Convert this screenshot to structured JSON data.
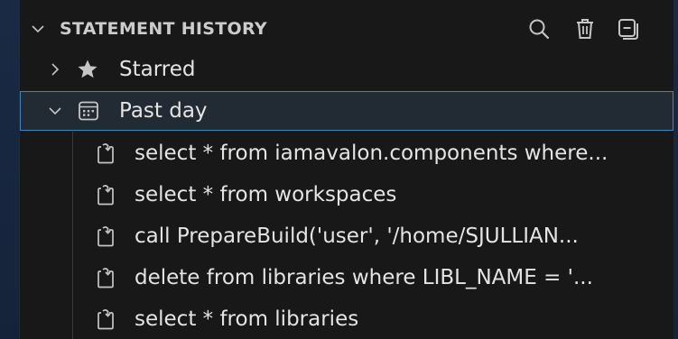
{
  "header": {
    "title": "STATEMENT HISTORY",
    "icons": [
      "search-icon",
      "trash-icon",
      "collapse-all-icon"
    ]
  },
  "groups": [
    {
      "label": "Starred",
      "icon": "star-icon",
      "expanded": false
    },
    {
      "label": "Past day",
      "icon": "calendar-icon",
      "expanded": true,
      "selected": true
    }
  ],
  "statements": [
    {
      "label": "select * from iamavalon.components where...",
      "icon": "history-run-icon"
    },
    {
      "label": "select * from workspaces",
      "icon": "history-run-icon"
    },
    {
      "label": "call PrepareBuild('user', '/home/SJULLIAN...",
      "icon": "history-run-icon"
    },
    {
      "label": "delete from libraries where LIBL_NAME = '...",
      "icon": "history-run-icon"
    },
    {
      "label": "select * from libraries",
      "icon": "history-run-icon"
    }
  ],
  "colors": {
    "panel_bg": "#181818",
    "text": "#e4e4e4",
    "selection_border": "#3f87b8",
    "icon": "#c5c5c5"
  }
}
